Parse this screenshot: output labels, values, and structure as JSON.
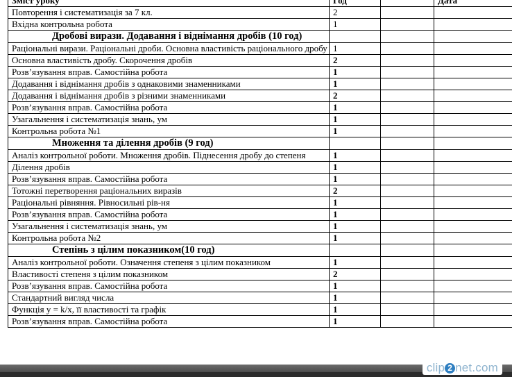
{
  "header": {
    "col_topic": "Зміст уроку",
    "col_hours": "Год",
    "col_date": "Дата"
  },
  "rows": [
    {
      "type": "row",
      "topic": "Повторення  і  систематизація  за  7  кл.",
      "hours": "2",
      "bold": false
    },
    {
      "type": "row",
      "topic": "Вхідна контрольна робота",
      "hours": "1",
      "bold": false
    },
    {
      "type": "section",
      "title": "Дробові вирази. Додавання і віднімання дробів (10 год)"
    },
    {
      "type": "row",
      "topic": "Раціональні вирази. Раціональні дроби. Основна властивість раціонального дробу",
      "hours": "1",
      "bold": false,
      "wrap": true
    },
    {
      "type": "row",
      "topic": "Основна властивість дробу. Скорочення дробів",
      "hours": "2",
      "bold": true
    },
    {
      "type": "row",
      "topic": "Розв’язування вправ. Самостійна робота",
      "hours": "1",
      "bold": true
    },
    {
      "type": "row",
      "topic": "Додавання і віднімання дробів з однаковими знаменниками",
      "hours": "1",
      "bold": true
    },
    {
      "type": "row",
      "topic": "Додавання і віднімання дробів з різними знаменниками",
      "hours": "2",
      "bold": true
    },
    {
      "type": "row",
      "topic": "Розв’язування вправ. Самостійна робота",
      "hours": "1",
      "bold": true
    },
    {
      "type": "row",
      "topic": "Узагальнення  і  систематизація знань, ум",
      "hours": "1",
      "bold": true
    },
    {
      "type": "row",
      "topic": "Контрольна  робота №1",
      "hours": "1",
      "bold": true
    },
    {
      "type": "section",
      "title": "Множення та ділення дробів (9 год)"
    },
    {
      "type": "row",
      "topic": "Аналіз контрольної роботи. Множення дробів. Піднесення дробу до степеня",
      "hours": "1",
      "bold": true,
      "wrap": true
    },
    {
      "type": "row",
      "topic": "Ділення дробів",
      "hours": "1",
      "bold": true
    },
    {
      "type": "row",
      "topic": "Розв’язування вправ. Самостійна робота",
      "hours": "1",
      "bold": true
    },
    {
      "type": "row",
      "topic": "Тотожні перетворення раціональних виразів",
      "hours": "2",
      "bold": true
    },
    {
      "type": "row",
      "topic": "Раціональні рівняння. Рівносильні рів-ня",
      "hours": "1",
      "bold": true
    },
    {
      "type": "row",
      "topic": "Розв’язування вправ. Самостійна робота",
      "hours": "1",
      "bold": true
    },
    {
      "type": "row",
      "topic": "Узагальнення  і  систематизація знань, ум",
      "hours": "1",
      "bold": true
    },
    {
      "type": "row",
      "topic": "Контрольна  робота №2",
      "hours": "1",
      "bold": true
    },
    {
      "type": "section",
      "title": "Степінь з цілим показником(10 год)"
    },
    {
      "type": "row",
      "topic": "Аналіз контрольної роботи. Означення степеня з цілим показником",
      "hours": "1",
      "bold": true
    },
    {
      "type": "row",
      "topic": "Властивості степеня з цілим показником",
      "hours": "2",
      "bold": true
    },
    {
      "type": "row",
      "topic": "Розв’язування вправ. Самостійна робота",
      "hours": "1",
      "bold": true
    },
    {
      "type": "row",
      "topic": "Стандартний вигляд числа",
      "hours": "1",
      "bold": true
    },
    {
      "type": "row",
      "topic": "Функція y  = k/x, її властивості та графік",
      "hours": "1",
      "bold": true
    },
    {
      "type": "row",
      "topic": "Розв’язування вправ. Самостійна робота",
      "hours": "1",
      "bold": true
    }
  ],
  "watermark": {
    "pre": "clip",
    "mid": "2",
    "post": "net.com"
  }
}
